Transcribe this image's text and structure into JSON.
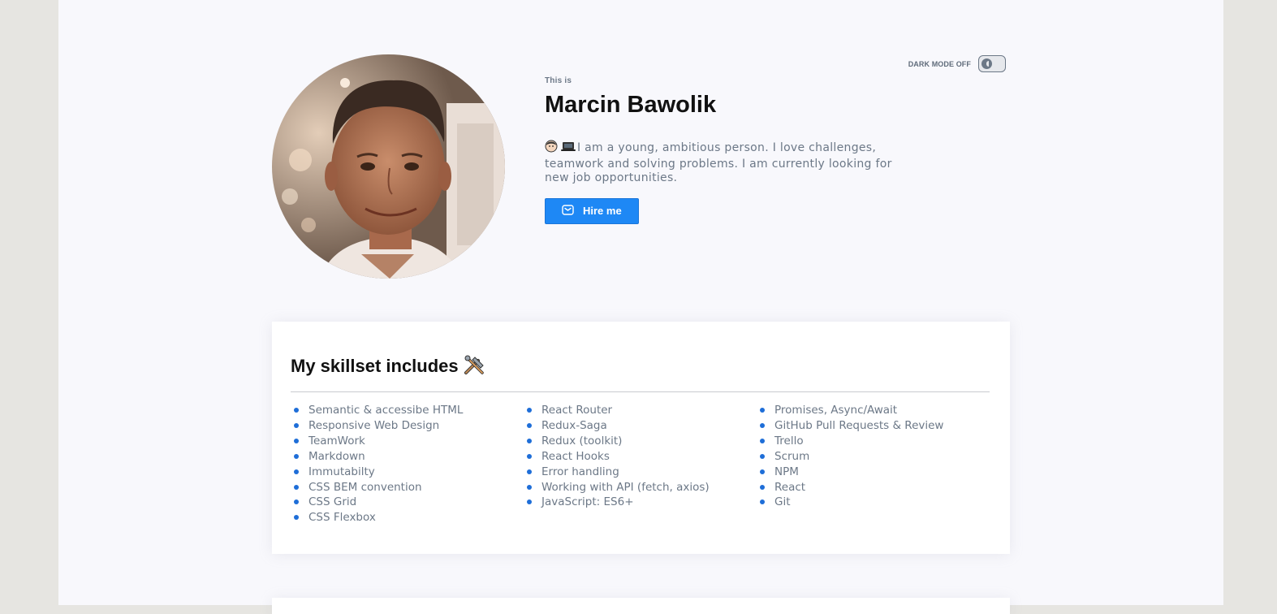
{
  "header": {
    "intro_label": "This is",
    "name": "Marcin Bawolik",
    "bio": "I am a young, ambitious person. I love challenges, teamwork and solving problems. I am currently looking for new job opportunities.",
    "hire_button_label": "Hire me",
    "avatar_alt": "Photo of Marcin Bawolik"
  },
  "theme_toggle": {
    "label": "DARK MODE OFF",
    "state": "off"
  },
  "skills": {
    "title": "My skillset includes",
    "columns": [
      [
        "Semantic & accessibe HTML",
        "Responsive Web Design",
        "TeamWork",
        "Markdown",
        "Immutabilty",
        "CSS BEM convention",
        "CSS Grid",
        "CSS Flexbox"
      ],
      [
        "React Router",
        "Redux-Saga",
        "Redux (toolkit)",
        "React Hooks",
        "Error handling",
        "Working with API (fetch, axios)",
        "JavaScript: ES6+"
      ],
      [
        "Promises, Async/Await",
        "GitHub Pull Requests & Review",
        "Trello",
        "Scrum",
        "NPM",
        "React",
        "Git"
      ]
    ]
  },
  "colors": {
    "accent": "#1e88f5",
    "bullet": "#1e6ed8",
    "muted_text": "#6c7887",
    "page_bg": "#f8f8fc",
    "outer_bg": "#e6e5e1"
  }
}
